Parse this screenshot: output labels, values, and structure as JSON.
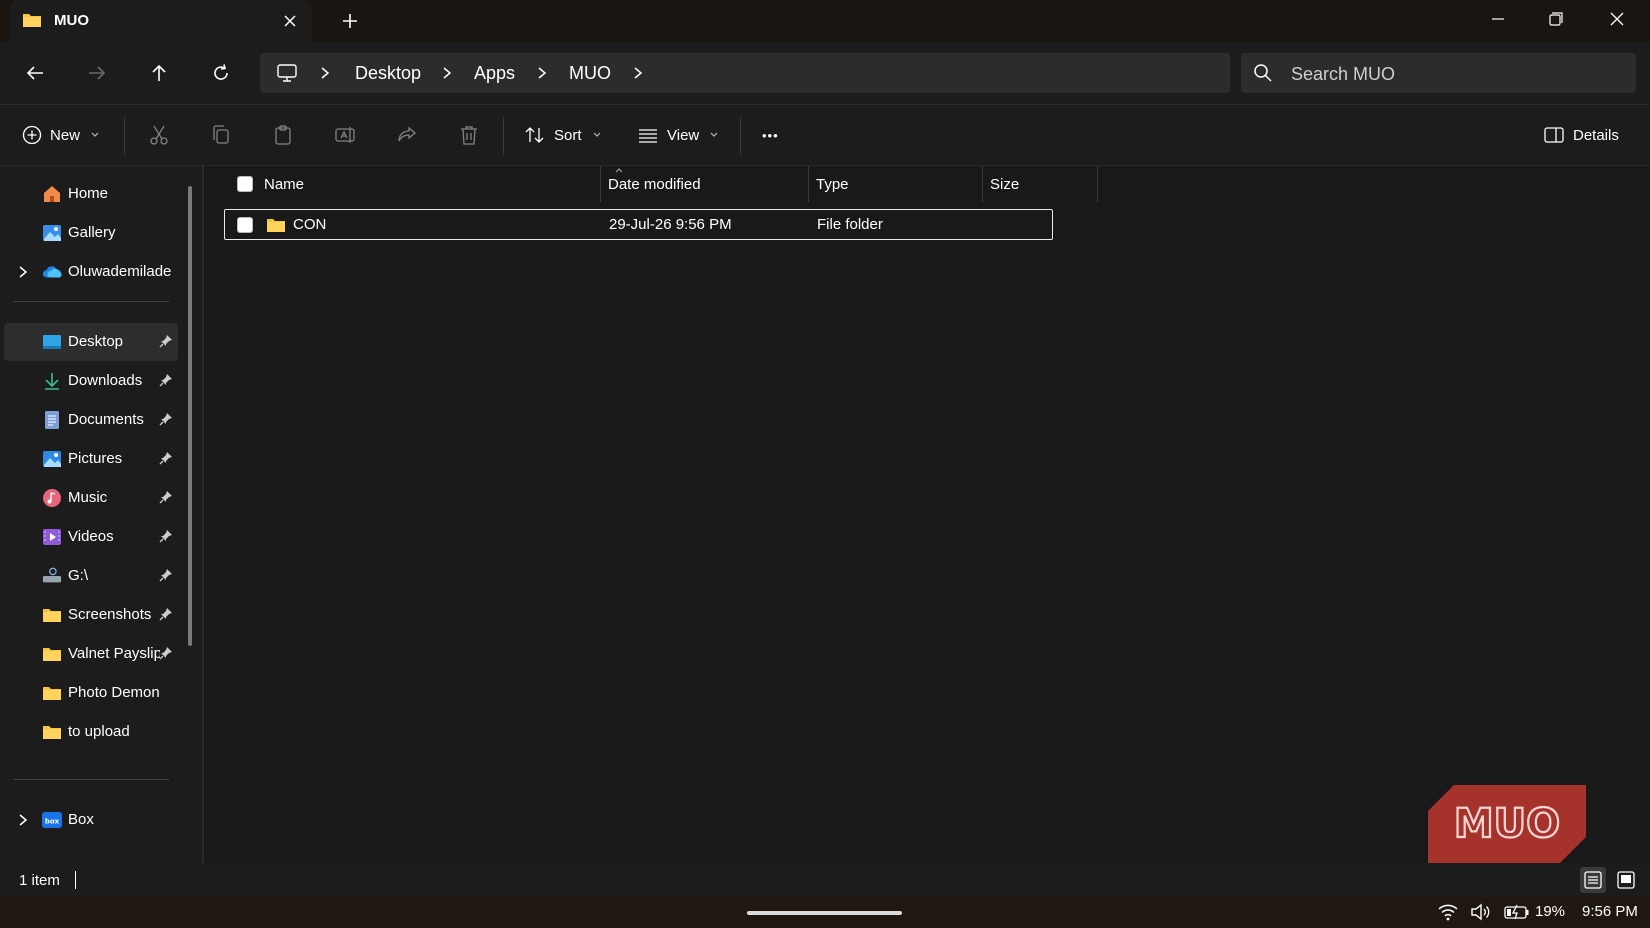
{
  "window": {
    "tab_title": "MUO",
    "new_tab": "+",
    "controls": [
      "minimize",
      "restore",
      "close"
    ]
  },
  "nav": {
    "breadcrumb": [
      "Desktop",
      "Apps",
      "MUO"
    ],
    "search_placeholder": "Search MUO"
  },
  "commands": {
    "new_label": "New",
    "sort_label": "Sort",
    "view_label": "View",
    "more_label": "•••",
    "details_label": "Details",
    "disabled_tools": [
      "cut-icon",
      "copy-icon",
      "paste-icon",
      "rename-icon",
      "share-icon",
      "delete-icon"
    ]
  },
  "sidebar": {
    "top_items": [
      {
        "label": "Home",
        "icon": "home-icon"
      },
      {
        "label": "Gallery",
        "icon": "gallery-icon"
      },
      {
        "label": "Oluwademilade",
        "icon": "onedrive-icon",
        "expandable": true
      }
    ],
    "quick_access": [
      {
        "label": "Desktop",
        "icon": "desktop-icon",
        "pinned": true,
        "selected": true
      },
      {
        "label": "Downloads",
        "icon": "downloads-icon",
        "pinned": true
      },
      {
        "label": "Documents",
        "icon": "documents-icon",
        "pinned": true
      },
      {
        "label": "Pictures",
        "icon": "pictures-icon",
        "pinned": true
      },
      {
        "label": "Music",
        "icon": "music-icon",
        "pinned": true
      },
      {
        "label": "Videos",
        "icon": "videos-icon",
        "pinned": true
      },
      {
        "label": "G:\\",
        "icon": "drive-icon",
        "pinned": true
      },
      {
        "label": "Screenshots",
        "icon": "folder-icon",
        "pinned": true
      },
      {
        "label": "Valnet Payslip",
        "icon": "folder-icon",
        "pinned": true
      },
      {
        "label": "Photo Demon",
        "icon": "folder-icon",
        "pinned": false
      },
      {
        "label": "to upload",
        "icon": "folder-icon",
        "pinned": false
      }
    ],
    "bottom_items": [
      {
        "label": "Box",
        "icon": "box-icon",
        "expandable": true
      }
    ]
  },
  "table": {
    "columns": [
      "Name",
      "Date modified",
      "Type",
      "Size"
    ],
    "rows": [
      {
        "name": "CON",
        "date": "29-Jul-26 9:56 PM",
        "type": "File folder",
        "size": ""
      }
    ]
  },
  "status": {
    "item_count": "1 item"
  },
  "watermark": {
    "text": "MUO",
    "color": "#b5362d"
  },
  "taskbar": {
    "battery": "19%",
    "time": "9:56 PM"
  },
  "colors": {
    "background": "#191919",
    "folder": "#f4c542",
    "accent": "#4cc2ff"
  }
}
